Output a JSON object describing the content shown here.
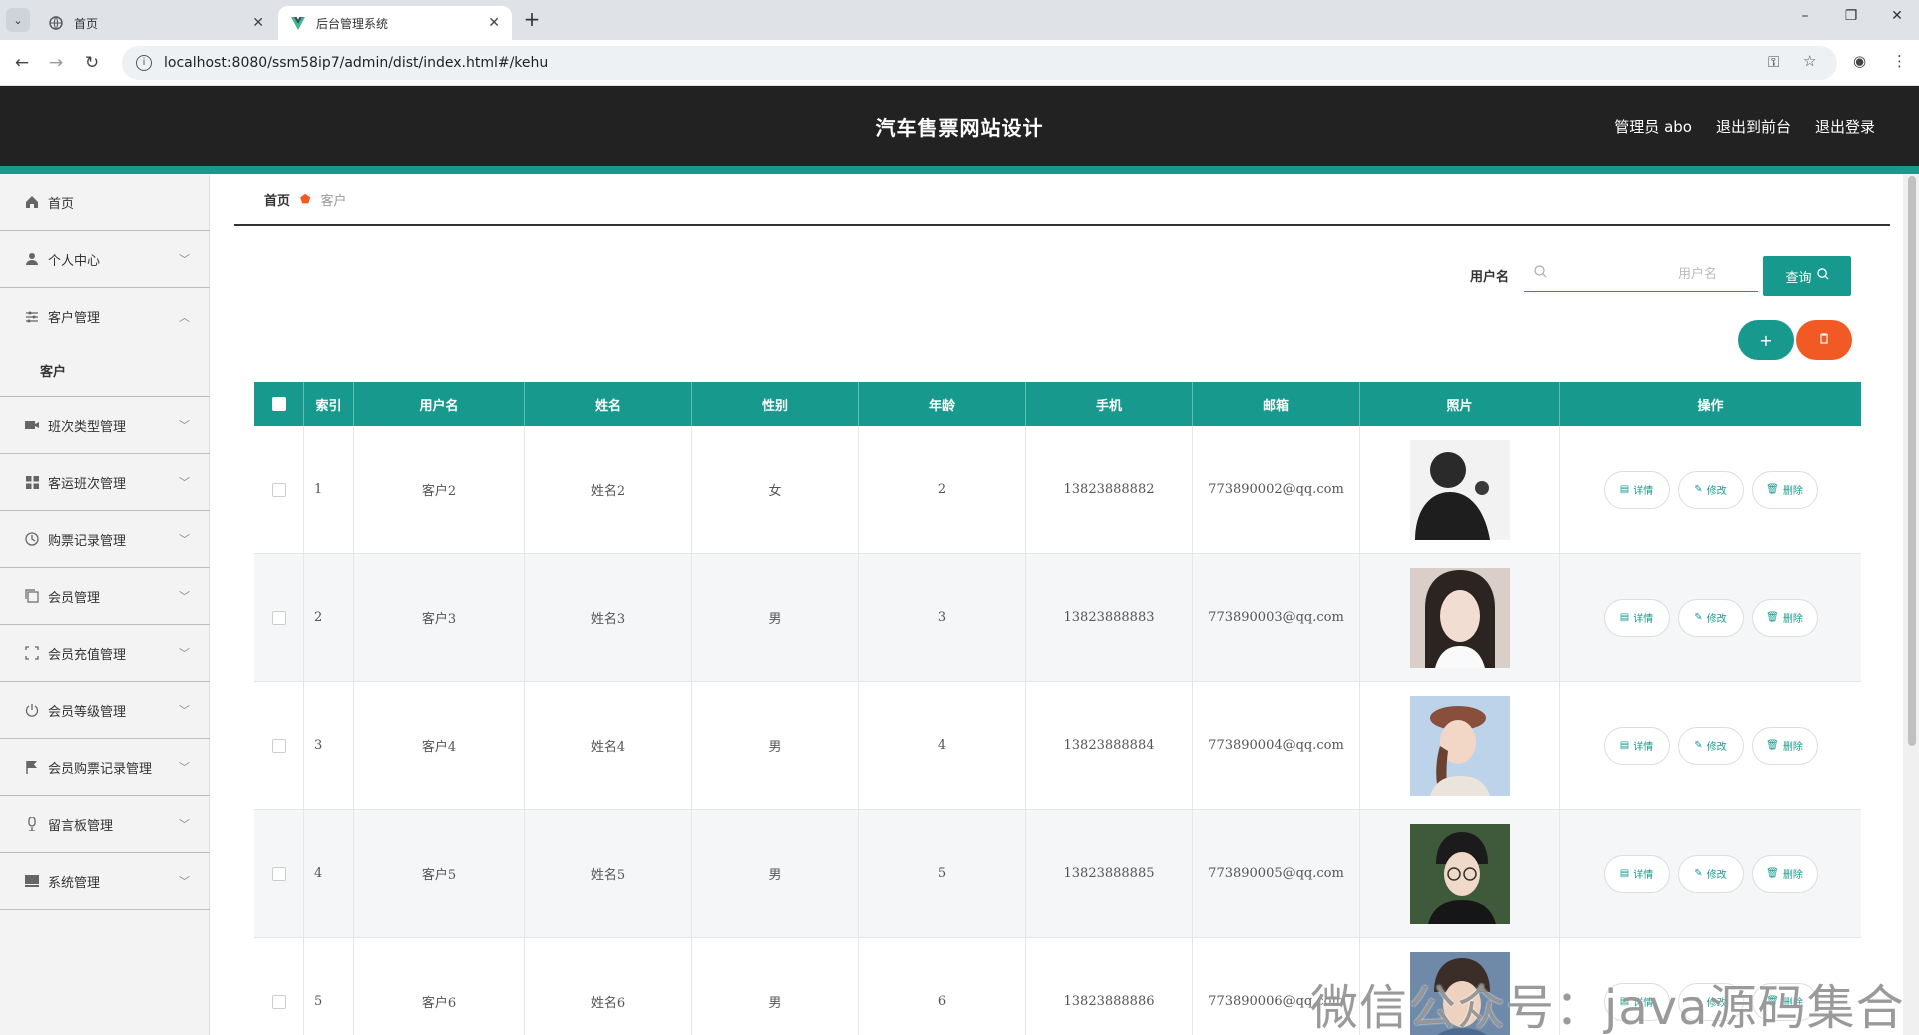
{
  "browser": {
    "tabs": [
      {
        "title": "首页",
        "active": false
      },
      {
        "title": "后台管理系统",
        "active": true
      }
    ],
    "url": "localhost:8080/ssm58ip7/admin/dist/index.html#/kehu",
    "new_tab": "+",
    "window_controls": {
      "minimize": "–",
      "restore": "❐",
      "close": "✕"
    }
  },
  "header": {
    "title": "汽车售票网站设计",
    "links": [
      "管理员 abo",
      "退出到前台",
      "退出登录"
    ]
  },
  "sidebar": {
    "items": [
      {
        "label": "首页",
        "icon": "home-icon"
      },
      {
        "label": "个人中心",
        "icon": "user-icon"
      },
      {
        "label": "客户管理",
        "icon": "sliders-icon",
        "expanded": true
      },
      {
        "label": "班次类型管理",
        "icon": "film-icon"
      },
      {
        "label": "客运班次管理",
        "icon": "grid-icon"
      },
      {
        "label": "购票记录管理",
        "icon": "clock-icon"
      },
      {
        "label": "会员管理",
        "icon": "copy-icon"
      },
      {
        "label": "会员充值管理",
        "icon": "frame-icon"
      },
      {
        "label": "会员等级管理",
        "icon": "power-icon"
      },
      {
        "label": "会员购票记录管理",
        "icon": "flag-icon"
      },
      {
        "label": "留言板管理",
        "icon": "mic-icon"
      },
      {
        "label": "系统管理",
        "icon": "box-icon"
      }
    ],
    "sub_item": "客户"
  },
  "breadcrumb": {
    "home": "首页",
    "current": "客户"
  },
  "search": {
    "label": "用户名",
    "placeholder": "用户名",
    "button": "查询"
  },
  "actions": {
    "add": "+",
    "delete": "🗑"
  },
  "table": {
    "columns": [
      "",
      "索引",
      "用户名",
      "姓名",
      "性别",
      "年龄",
      "手机",
      "邮箱",
      "照片",
      "操作"
    ],
    "rows": [
      {
        "index": "1",
        "username": "客户2",
        "name": "姓名2",
        "gender": "女",
        "age": "2",
        "phone": "13823888882",
        "email": "773890002@qq.com"
      },
      {
        "index": "2",
        "username": "客户3",
        "name": "姓名3",
        "gender": "男",
        "age": "3",
        "phone": "13823888883",
        "email": "773890003@qq.com"
      },
      {
        "index": "3",
        "username": "客户4",
        "name": "姓名4",
        "gender": "男",
        "age": "4",
        "phone": "13823888884",
        "email": "773890004@qq.com"
      },
      {
        "index": "4",
        "username": "客户5",
        "name": "姓名5",
        "gender": "男",
        "age": "5",
        "phone": "13823888885",
        "email": "773890005@qq.com"
      },
      {
        "index": "5",
        "username": "客户6",
        "name": "姓名6",
        "gender": "男",
        "age": "6",
        "phone": "13823888886",
        "email": "773890006@qq.com"
      }
    ],
    "row_buttons": {
      "detail": "详情",
      "edit": "修改",
      "remove": "删除"
    }
  },
  "watermark": "微信公众号：java源码集合",
  "colors": {
    "accent": "#179a8d",
    "danger": "#f15a24",
    "header_bg": "#222222"
  }
}
